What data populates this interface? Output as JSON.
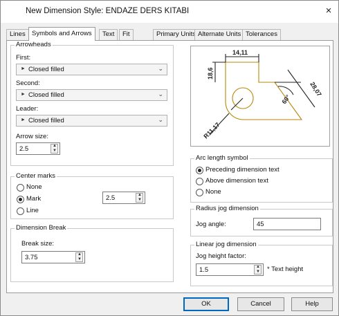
{
  "dialog": {
    "title": "New Dimension Style: ENDAZE DERS KITABI",
    "close_glyph": "×"
  },
  "tabs": [
    {
      "label": "Lines"
    },
    {
      "label": "Symbols and Arrows"
    },
    {
      "label": "Text"
    },
    {
      "label": "Fit"
    },
    {
      "label": "Primary Units"
    },
    {
      "label": "Alternate Units"
    },
    {
      "label": "Tolerances"
    }
  ],
  "active_tab": "Symbols and Arrows",
  "arrowheads": {
    "title": "Arrowheads",
    "first_label": "First:",
    "first_value": "Closed filled",
    "second_label": "Second:",
    "second_value": "Closed filled",
    "leader_label": "Leader:",
    "leader_value": "Closed filled",
    "arrow_size_label": "Arrow size:",
    "arrow_size_value": "2.5"
  },
  "center_marks": {
    "title": "Center marks",
    "options": [
      "None",
      "Mark",
      "Line"
    ],
    "selected": "Mark",
    "size_value": "2.5"
  },
  "dimension_break": {
    "title": "Dimension Break",
    "break_size_label": "Break size:",
    "break_size_value": "3.75"
  },
  "preview": {
    "dim_top": "14,11",
    "dim_left": "18,6",
    "dim_right": "28,07",
    "dim_angle": "60°",
    "dim_radius": "R11,17",
    "line_color": "#b8860b",
    "dim_color": "#222222"
  },
  "arc_length": {
    "title": "Arc length symbol",
    "options": [
      "Preceding dimension text",
      "Above dimension text",
      "None"
    ],
    "selected": "Preceding dimension text"
  },
  "radius_jog": {
    "title": "Radius jog dimension",
    "jog_angle_label": "Jog angle:",
    "jog_angle_value": "45"
  },
  "linear_jog": {
    "title": "Linear jog dimension",
    "height_factor_label": "Jog height factor:",
    "height_factor_value": "1.5",
    "height_suffix": "* Text height"
  },
  "buttons": {
    "ok": "OK",
    "cancel": "Cancel",
    "help": "Help"
  },
  "colors": {
    "focus_blue": "#0067c0",
    "dialog_bg": "#f0f0f0"
  }
}
